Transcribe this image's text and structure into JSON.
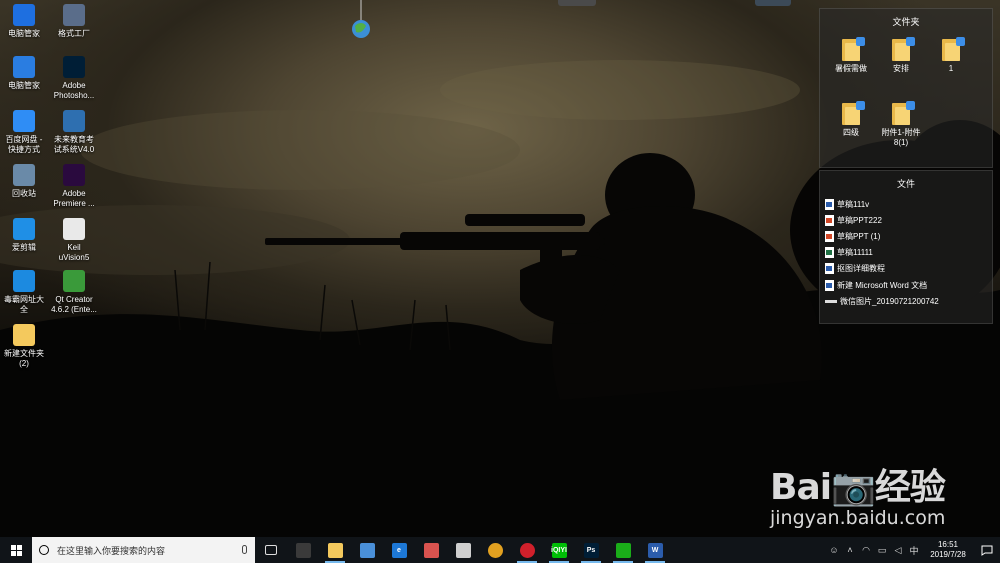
{
  "desktop_icons": [
    {
      "label": "电脑管家",
      "icon": "pc-manager-icon",
      "color": "#1e6fe0"
    },
    {
      "label": "格式工厂",
      "icon": "format-factory-icon",
      "color": "#5a6d8a"
    },
    {
      "label": "电脑管家",
      "icon": "pc-manager-icon",
      "color": "#2a7de1"
    },
    {
      "label": "Adobe\nPhotosho...",
      "icon": "photoshop-icon",
      "color": "#001e36"
    },
    {
      "label": "百度网盘 -\n快捷方式",
      "icon": "baidu-netdisk-icon",
      "color": "#2f8df5"
    },
    {
      "label": "未来教育考\n试系统V4.0",
      "icon": "exam-system-icon",
      "color": "#2e6fb0"
    },
    {
      "label": "回收站",
      "icon": "recycle-bin-icon",
      "color": "#6a8aa8"
    },
    {
      "label": "Adobe\nPremiere ...",
      "icon": "premiere-icon",
      "color": "#2a0a3e"
    },
    {
      "label": "爱剪辑",
      "icon": "ai-jianji-icon",
      "color": "#1f8fe6"
    },
    {
      "label": "Keil\nuVision5",
      "icon": "keil-icon",
      "color": "#e9e9e9"
    },
    {
      "label": "毒霸网址大\n全",
      "icon": "ie-browser-icon",
      "color": "#1c8ae0"
    },
    {
      "label": "Qt Creator\n4.6.2 (Ente...",
      "icon": "qt-creator-icon",
      "color": "#3a9a3a"
    },
    {
      "label": "新建文件夹\n(2)",
      "icon": "folder-icon",
      "color": "#f4c95d"
    }
  ],
  "fence_folders": {
    "title": "文件夹",
    "items": [
      {
        "label": "暑假需做"
      },
      {
        "label": "安排"
      },
      {
        "label": "1"
      },
      {
        "label": "四级"
      },
      {
        "label": "附件1-附件\n8(1)"
      }
    ]
  },
  "fence_files": {
    "title": "文件",
    "items": [
      {
        "label": "草稿111v",
        "type": "word"
      },
      {
        "label": "草稿PPT222",
        "type": "ppt"
      },
      {
        "label": "草稿PPT (1)",
        "type": "ppt"
      },
      {
        "label": "草稿11111",
        "type": "xls"
      },
      {
        "label": "抠图详细教程",
        "type": "word"
      },
      {
        "label": "新建 Microsoft Word 文档",
        "type": "word"
      },
      {
        "label": "微信图片_20190721200742",
        "type": "img"
      }
    ]
  },
  "watermark": {
    "logo": "Bai📷经验",
    "url": "jingyan.baidu.com"
  },
  "taskbar": {
    "search_placeholder": "在这里输入你要搜索的内容",
    "apps": [
      {
        "name": "task-view",
        "label": ""
      },
      {
        "name": "store",
        "label": ""
      },
      {
        "name": "file-explorer",
        "label": ""
      },
      {
        "name": "app-4",
        "label": ""
      },
      {
        "name": "edge",
        "label": "e"
      },
      {
        "name": "app-6",
        "label": ""
      },
      {
        "name": "app-7",
        "label": ""
      },
      {
        "name": "chrome",
        "label": ""
      },
      {
        "name": "netease-music",
        "label": ""
      },
      {
        "name": "iqiyi",
        "label": "iQIYI"
      },
      {
        "name": "photoshop",
        "label": "Ps"
      },
      {
        "name": "wechat",
        "label": ""
      },
      {
        "name": "word",
        "label": "W"
      }
    ],
    "tray": {
      "lang": "中",
      "time": "16:51",
      "date": "2019/7/28"
    }
  }
}
